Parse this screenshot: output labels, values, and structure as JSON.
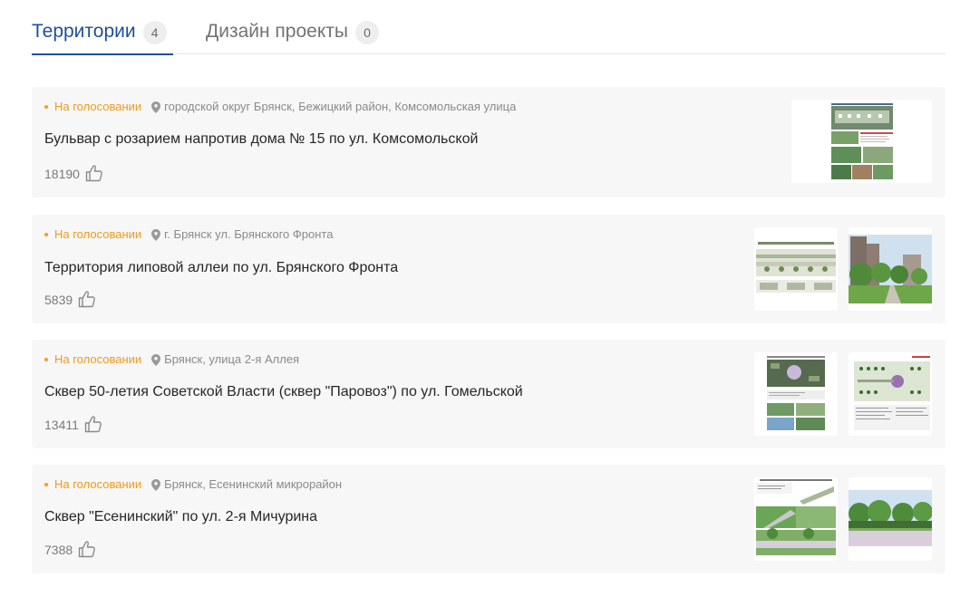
{
  "tabs": [
    {
      "label": "Территории",
      "count": "4"
    },
    {
      "label": "Дизайн проекты",
      "count": "0"
    }
  ],
  "colors": {
    "accent": "#1f4e9c",
    "status": "#ef9a1a",
    "card_bg": "#f7f7f7"
  },
  "icons": {
    "location": "map-pin-icon",
    "like": "thumbs-up-icon"
  },
  "projects": [
    {
      "status": "На голосовании",
      "address": "городской округ Брянск, Бежицкий район, Комсомольская улица",
      "title": "Бульвар с розарием напротив дома № 15 по ул. Комсомольской",
      "likes": "18190"
    },
    {
      "status": "На голосовании",
      "address": "г. Брянск ул. Брянского Фронта",
      "title": "Территория липовой аллеи по ул. Брянского Фронта",
      "likes": "5839"
    },
    {
      "status": "На голосовании",
      "address": "Брянск, улица 2-я Аллея",
      "title": "Сквер 50-летия Советской Власти (сквер \"Паровоз\") по ул. Гомельской",
      "likes": "13411"
    },
    {
      "status": "На голосовании",
      "address": "Брянск, Есенинский микрорайон",
      "title": "Сквер \"Есенинский\" по ул. 2-я Мичурина",
      "likes": "7388"
    }
  ]
}
